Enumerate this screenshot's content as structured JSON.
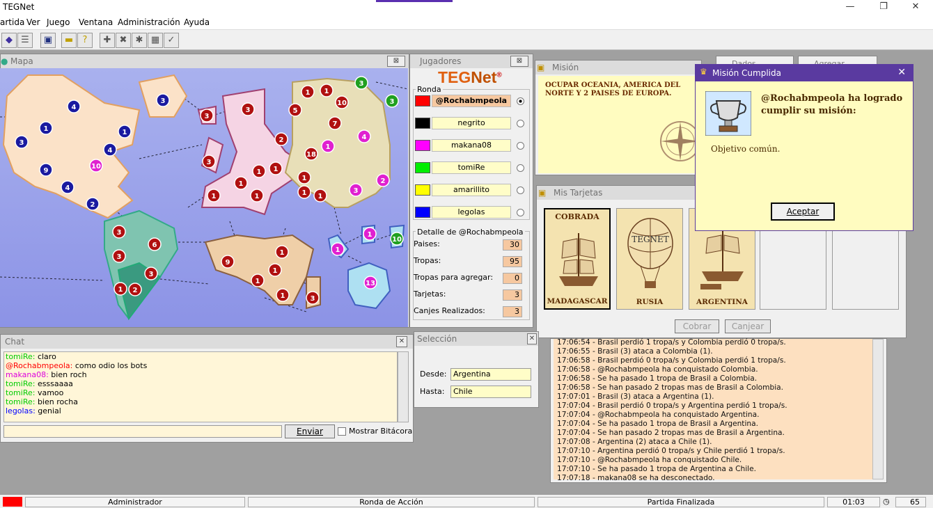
{
  "app": {
    "title": "TEGNet"
  },
  "menu": [
    "artida",
    "Ver",
    "Juego",
    "Ventana",
    "Administración",
    "Ayuda"
  ],
  "toolbar": {
    "icons": [
      "connect-icon",
      "list-icon",
      "save-icon",
      "card-icon",
      "help-card-icon",
      "add-icon",
      "remove-icon",
      "gear-icon",
      "copy-icon",
      "check-icon"
    ]
  },
  "map_window": {
    "title": "Mapa",
    "close": "⊠"
  },
  "players_window": {
    "title": "Jugadores",
    "logo_a": "TEG",
    "logo_b": "Net",
    "logo_reg": "®",
    "round_label": "Ronda",
    "players": [
      {
        "name": "@Rochabmpeola",
        "color": "#ff0000"
      },
      {
        "name": "negrito",
        "color": "#000000"
      },
      {
        "name": "makana08",
        "color": "#ff00ff"
      },
      {
        "name": "tomiRe",
        "color": "#00ee00"
      },
      {
        "name": "amarillito",
        "color": "#ffff00"
      },
      {
        "name": "legolas",
        "color": "#0000ff"
      }
    ],
    "detail_title": "Detalle de @Rochabmpeola",
    "details": [
      {
        "label": "Paises:",
        "value": "30"
      },
      {
        "label": "Tropas:",
        "value": "95"
      },
      {
        "label": "Tropas para agregar:",
        "value": "0"
      },
      {
        "label": "Tarjetas:",
        "value": "3"
      },
      {
        "label": "Canjes Realizados:",
        "value": "3"
      }
    ]
  },
  "mission_window": {
    "title": "Misión",
    "text": "OCUPAR OCEANIA, AMERICA DEL NORTE Y 2 PAISES DE EUROPA."
  },
  "cards_window": {
    "title": "Mis Tarjetas",
    "cards": [
      {
        "top": "COBRADA",
        "country": "MADAGASCAR"
      },
      {
        "top": "",
        "country": "RUSIA",
        "logo": "TEGNET"
      },
      {
        "top": "",
        "country": "ARGENTINA"
      }
    ],
    "cobrar": "Cobrar",
    "canjear": "Canjear"
  },
  "dialog": {
    "title": "Misión Cumplida",
    "message": "@Rochabmpeola ha logrado cumplir su misión:",
    "objective": "Objetivo común.",
    "accept": "Aceptar",
    "close": "✕"
  },
  "chat_window": {
    "title": "Chat",
    "lines": [
      {
        "nick": "tomiRe:",
        "text": "claro",
        "color": "#00cc00"
      },
      {
        "nick": "@Rochabmpeola:",
        "text": "como odio los bots",
        "color": "#ff0000"
      },
      {
        "nick": "makana08:",
        "text": "bien roch",
        "color": "#dd00dd"
      },
      {
        "nick": "tomiRe:",
        "text": "esssaaaa",
        "color": "#00cc00"
      },
      {
        "nick": "tomiRe:",
        "text": "vamoo",
        "color": "#00cc00"
      },
      {
        "nick": "tomiRe:",
        "text": "bien rocha",
        "color": "#00cc00"
      },
      {
        "nick": "legolas:",
        "text": "genial",
        "color": "#0000ff"
      }
    ],
    "input_value": "",
    "send": "Enviar",
    "show_log": "Mostrar Bitácora"
  },
  "selection_window": {
    "title": "Selección",
    "from_label": "Desde:",
    "from_value": "Argentina",
    "to_label": "Hasta:",
    "to_value": "Chile"
  },
  "log": [
    "17:06:54 - Brasil perdió 1 tropa/s y Colombia perdió 0 tropa/s.",
    "17:06:55 - Brasil (3) ataca a Colombia (1).",
    "17:06:58 - Brasil perdió 0 tropa/s y Colombia perdió 1 tropa/s.",
    "17:06:58 - @Rochabmpeola ha conquistado Colombia.",
    "17:06:58 - Se ha pasado 1 tropa de Brasil a Colombia.",
    "17:06:58 - Se han pasado 2 tropas mas de Brasil a Colombia.",
    "17:07:01 - Brasil (3) ataca a Argentina (1).",
    "17:07:04 - Brasil perdió 0 tropa/s y Argentina perdió 1 tropa/s.",
    "17:07:04 - @Rochabmpeola ha conquistado Argentina.",
    "17:07:04 - Se ha pasado 1 tropa de Brasil a Argentina.",
    "17:07:04 - Se han pasado 2 tropas mas de Brasil a Argentina.",
    "17:07:08 - Argentina (2) ataca a Chile (1).",
    "17:07:10 - Argentina perdió 0 tropa/s y Chile perdió 1 tropa/s.",
    "17:07:10 - @Rochabmpeola ha conquistado Chile.",
    "17:07:10 - Se ha pasado 1 tropa de Argentina a Chile.",
    "17:07:18 - makana08 se ha desconectado."
  ],
  "hidden_tabs": [
    "Dados",
    "Agregar"
  ],
  "status": {
    "role": "Administrador",
    "phase": "Ronda de Acción",
    "state": "Partida Finalizada",
    "time": "01:03",
    "count": "65",
    "color": "#ff0000"
  },
  "armies": [
    {
      "n": "4",
      "c": "#1a1aa0"
    },
    {
      "n": "3",
      "c": "#1a1aa0"
    },
    {
      "n": "1",
      "c": "#1a1aa0"
    },
    {
      "n": "1",
      "c": "#1a1aa0"
    },
    {
      "n": "3",
      "c": "#1a1aa0"
    },
    {
      "n": "4",
      "c": "#1a1aa0"
    },
    {
      "n": "9",
      "c": "#1a1aa0"
    },
    {
      "n": "10",
      "c": "#e020d0"
    },
    {
      "n": "4",
      "c": "#1a1aa0"
    },
    {
      "n": "2",
      "c": "#1a1aa0"
    },
    {
      "n": "3",
      "c": "#b01010"
    },
    {
      "n": "3",
      "c": "#b01010"
    },
    {
      "n": "3",
      "c": "#b01010"
    },
    {
      "n": "1",
      "c": "#b01010"
    },
    {
      "n": "1",
      "c": "#b01010"
    },
    {
      "n": "1",
      "c": "#b01010"
    },
    {
      "n": "1",
      "c": "#b01010"
    },
    {
      "n": "1",
      "c": "#b01010"
    },
    {
      "n": "2",
      "c": "#b01010"
    },
    {
      "n": "1",
      "c": "#b01010"
    },
    {
      "n": "1",
      "c": "#b01010"
    },
    {
      "n": "5",
      "c": "#b01010"
    },
    {
      "n": "10",
      "c": "#b01010"
    },
    {
      "n": "7",
      "c": "#b01010"
    },
    {
      "n": "18",
      "c": "#b01010"
    },
    {
      "n": "1",
      "c": "#e020d0"
    },
    {
      "n": "4",
      "c": "#e020d0"
    },
    {
      "n": "1",
      "c": "#b01010"
    },
    {
      "n": "1",
      "c": "#b01010"
    },
    {
      "n": "1",
      "c": "#b01010"
    },
    {
      "n": "3",
      "c": "#e020d0"
    },
    {
      "n": "2",
      "c": "#e020d0"
    },
    {
      "n": "3",
      "c": "#20a020"
    },
    {
      "n": "3",
      "c": "#20a020"
    },
    {
      "n": "3",
      "c": "#b01010"
    },
    {
      "n": "6",
      "c": "#b01010"
    },
    {
      "n": "3",
      "c": "#b01010"
    },
    {
      "n": "3",
      "c": "#b01010"
    },
    {
      "n": "1",
      "c": "#b01010"
    },
    {
      "n": "2",
      "c": "#b01010"
    },
    {
      "n": "9",
      "c": "#b01010"
    },
    {
      "n": "1",
      "c": "#b01010"
    },
    {
      "n": "1",
      "c": "#b01010"
    },
    {
      "n": "1",
      "c": "#b01010"
    },
    {
      "n": "1",
      "c": "#b01010"
    },
    {
      "n": "3",
      "c": "#b01010"
    },
    {
      "n": "1",
      "c": "#e020d0"
    },
    {
      "n": "1",
      "c": "#e020d0"
    },
    {
      "n": "10",
      "c": "#20a020"
    },
    {
      "n": "13",
      "c": "#e020d0"
    }
  ]
}
